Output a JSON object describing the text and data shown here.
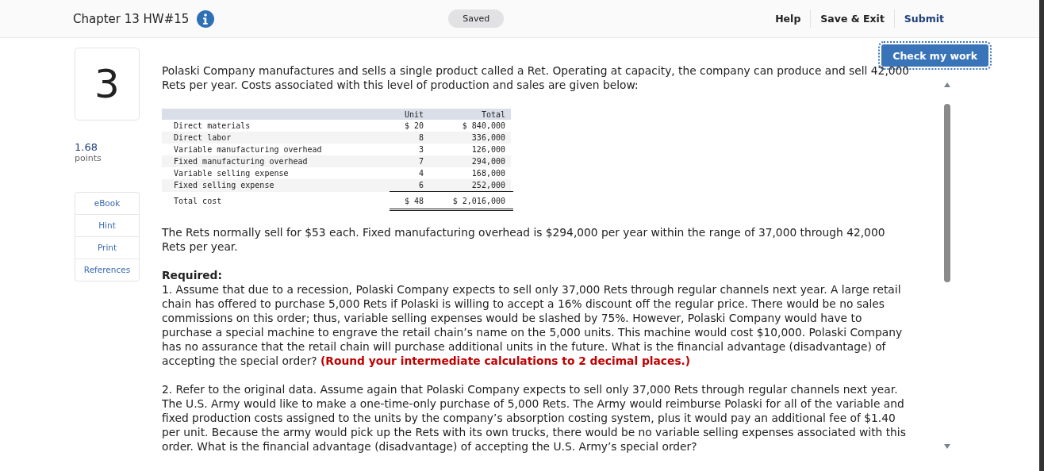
{
  "header": {
    "title": "Chapter 13 HW#15",
    "status": "Saved",
    "links": [
      "Help",
      "Save & Exit",
      "Submit"
    ]
  },
  "check_button": "Check my work",
  "question": {
    "number": "3",
    "points": "1.68",
    "points_label": "points"
  },
  "tools": [
    "eBook",
    "Hint",
    "Print",
    "References"
  ],
  "intro": "Polaski Company manufactures and sells a single product called a Ret. Operating at capacity, the company can produce and sell 42,000 Rets per year. Costs associated with this level of production and sales are given below:",
  "table": {
    "columns": [
      "Unit",
      "Total"
    ],
    "rows": [
      {
        "label": "Direct materials",
        "unit": "$ 20",
        "total": "$ 840,000"
      },
      {
        "label": "Direct labor",
        "unit": "8",
        "total": "336,000"
      },
      {
        "label": "Variable manufacturing overhead",
        "unit": "3",
        "total": "126,000"
      },
      {
        "label": "Fixed manufacturing overhead",
        "unit": "7",
        "total": "294,000"
      },
      {
        "label": "Variable selling expense",
        "unit": "4",
        "total": "168,000"
      },
      {
        "label": "Fixed selling expense",
        "unit": "6",
        "total": "252,000"
      }
    ],
    "total": {
      "label": "Total cost",
      "unit": "$ 48",
      "total": "$ 2,016,000"
    }
  },
  "after_table": "The Rets normally sell for $53 each. Fixed manufacturing overhead is $294,000 per year within the range of 37,000 through 42,000 Rets per year.",
  "required_heading": "Required:",
  "required": [
    "1. Assume that due to a recession, Polaski Company expects to sell only 37,000 Rets through regular channels next year. A large retail chain has offered to purchase 5,000 Rets if Polaski is willing to accept a 16% discount off the regular price. There would be no sales commissions on this order; thus, variable selling expenses would be slashed by 75%. However, Polaski Company would have to purchase a special machine to engrave the retail chain’s name on the 5,000 units. This machine would cost $10,000. Polaski Company has no assurance that the retail chain will purchase additional units in the future. What is the financial advantage (disadvantage) of accepting the special order? **(Round your intermediate calculations to 2 decimal places.)**",
    "2. Refer to the original data. Assume again that Polaski Company expects to sell only 37,000 Rets through regular channels next year. The U.S. Army would like to make a one-time-only purchase of 5,000 Rets. The Army would reimburse Polaski for all of the variable and fixed production costs assigned to the units by the company’s absorption costing system, plus it would pay an additional fee of $1.40 per unit. Because the army would pick up the Rets with its own trucks, there would be no variable selling expenses associated with this order. What is the financial advantage (disadvantage) of accepting the U.S. Army’s special order?"
  ]
}
